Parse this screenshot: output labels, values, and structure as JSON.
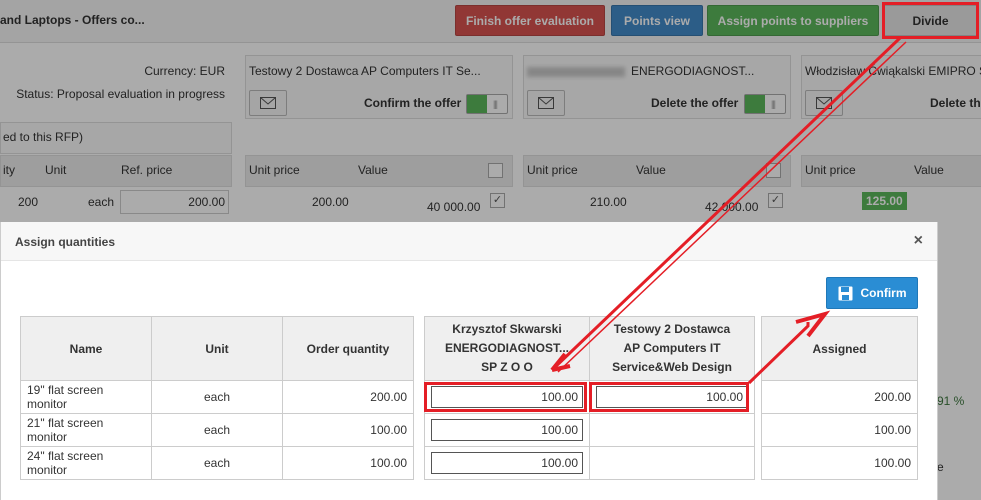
{
  "header": {
    "title": "and Laptops - Offers co...",
    "buttons": {
      "finish": "Finish offer evaluation",
      "points_view": "Points view",
      "assign_points": "Assign points to suppliers",
      "divide": "Divide"
    }
  },
  "rfp_info": {
    "currency": "Currency: EUR",
    "status": "Status: Proposal evaluation in progress",
    "note": "ed to this RFP)",
    "columns": [
      "ity",
      "Unit",
      "Ref. price"
    ],
    "row": {
      "qty": "200",
      "unit": "each",
      "ref_price": "200.00"
    }
  },
  "suppliers_bg": [
    {
      "name": "Testowy 2 Dostawca AP Computers IT Se...",
      "toggle_label": "Confirm the offer",
      "unit_price": "200.00",
      "value": "40 000.00"
    },
    {
      "name": "ENERGODIAGNOST...",
      "toggle_label": "Delete the offer",
      "unit_price": "210.00",
      "value": "42 000.00"
    },
    {
      "name": "Włodzisław Ćwiąkalski EMIPRO Se",
      "toggle_label": "Delete the",
      "unit_price": "125.00",
      "value": ""
    }
  ],
  "bg_columns": {
    "unit_price": "Unit price",
    "value": "Value"
  },
  "bg_fragments": {
    "percent": "91 %",
    "e": "e"
  },
  "modal": {
    "title": "Assign quantities",
    "close": "×",
    "confirm_label": "Confirm",
    "columns": {
      "name": "Name",
      "unit": "Unit",
      "order_qty": "Order quantity",
      "supplier1": [
        "Krzysztof Skwarski",
        "ENERGODIAGNOST...",
        "SP Z O O"
      ],
      "supplier2": [
        "Testowy 2 Dostawca",
        "AP Computers IT",
        "Service&Web Design"
      ],
      "assigned": "Assigned"
    },
    "rows": [
      {
        "name": "19\" flat screen monitor",
        "unit": "each",
        "order_qty": "200.00",
        "s1": "100.00",
        "s2": "100.00",
        "assigned": "200.00"
      },
      {
        "name": "21\" flat screen monitor",
        "unit": "each",
        "order_qty": "100.00",
        "s1": "100.00",
        "s2": "",
        "assigned": "100.00"
      },
      {
        "name": "24\" flat screen monitor",
        "unit": "each",
        "order_qty": "100.00",
        "s1": "100.00",
        "s2": "",
        "assigned": "100.00"
      }
    ]
  },
  "annotations": {
    "color": "#e41e26"
  }
}
